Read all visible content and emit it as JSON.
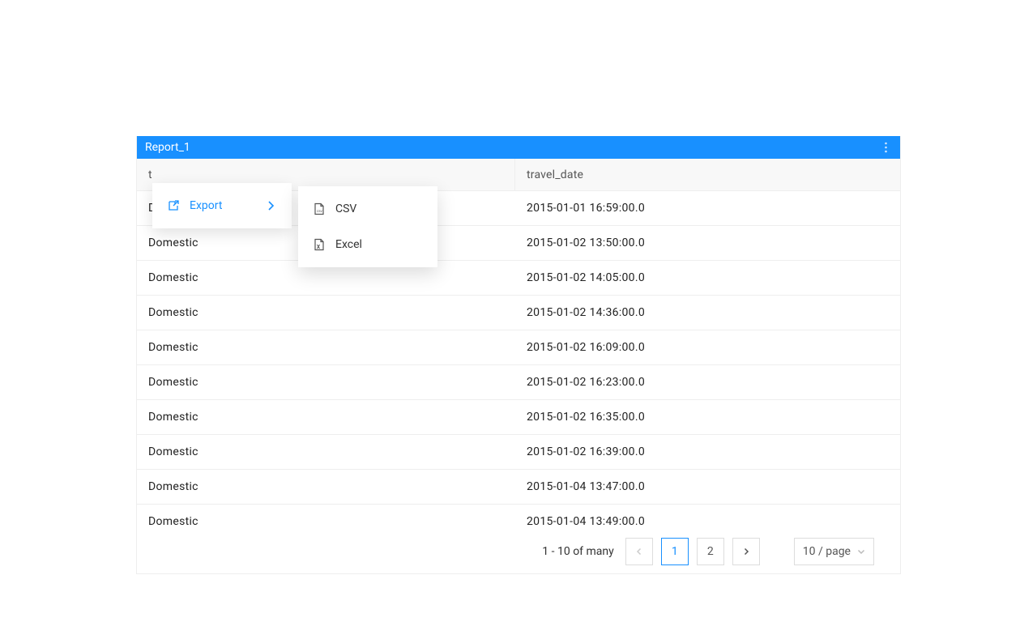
{
  "panel": {
    "title": "Report_1"
  },
  "table": {
    "columns": [
      "t",
      "travel_date"
    ],
    "rows": [
      {
        "type": "Domestic",
        "date": "2015-01-01 16:59:00.0"
      },
      {
        "type": "Domestic",
        "date": "2015-01-02 13:50:00.0"
      },
      {
        "type": "Domestic",
        "date": "2015-01-02 14:05:00.0"
      },
      {
        "type": "Domestic",
        "date": "2015-01-02 14:36:00.0"
      },
      {
        "type": "Domestic",
        "date": "2015-01-02 16:09:00.0"
      },
      {
        "type": "Domestic",
        "date": "2015-01-02 16:23:00.0"
      },
      {
        "type": "Domestic",
        "date": "2015-01-02 16:35:00.0"
      },
      {
        "type": "Domestic",
        "date": "2015-01-02 16:39:00.0"
      },
      {
        "type": "Domestic",
        "date": "2015-01-04 13:47:00.0"
      },
      {
        "type": "Domestic",
        "date": "2015-01-04 13:49:00.0"
      }
    ]
  },
  "pagination": {
    "info": "1 - 10 of many",
    "pages": [
      "1",
      "2"
    ],
    "active": "1",
    "page_size_label": "10 / page"
  },
  "menu": {
    "export_label": "Export",
    "csv_label": "CSV",
    "excel_label": "Excel"
  }
}
